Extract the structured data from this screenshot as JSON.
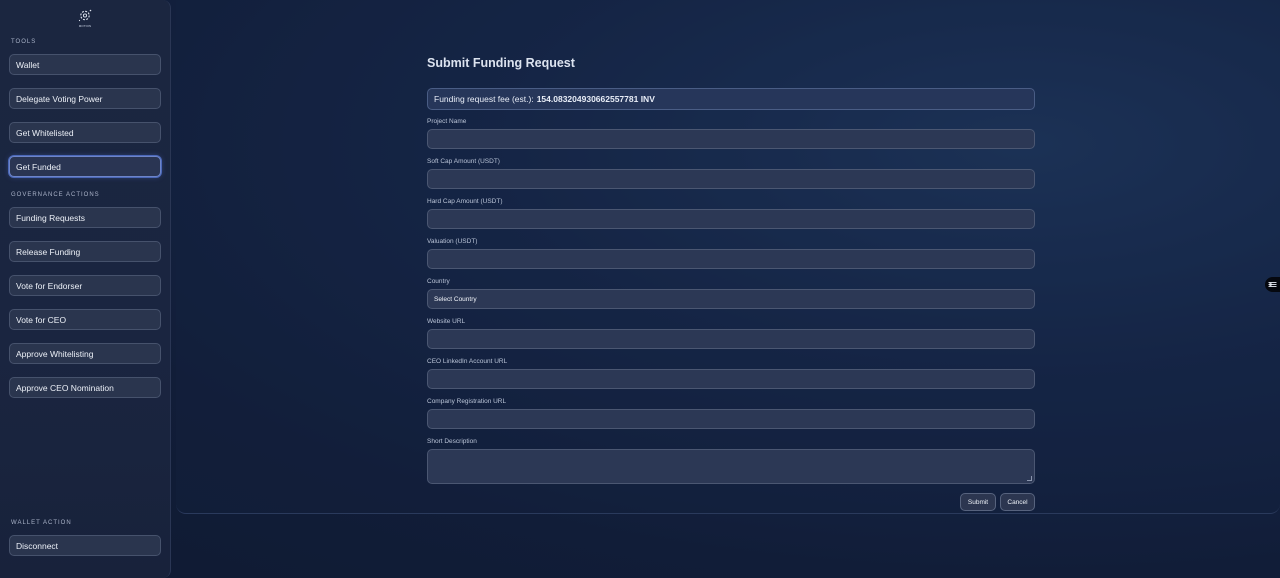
{
  "logo": {
    "icon": "gear-sparkle-icon",
    "text": "MOTION"
  },
  "sidebar": {
    "tools_label": "TOOLS",
    "tools": [
      {
        "label": "Wallet"
      },
      {
        "label": "Delegate Voting Power"
      },
      {
        "label": "Get Whitelisted"
      },
      {
        "label": "Get Funded",
        "active": true
      }
    ],
    "governance_label": "GOVERNANCE ACTIONS",
    "governance": [
      {
        "label": "Funding Requests"
      },
      {
        "label": "Release Funding"
      },
      {
        "label": "Vote for Endorser"
      },
      {
        "label": "Vote for CEO"
      },
      {
        "label": "Approve Whitelisting"
      },
      {
        "label": "Approve CEO Nomination"
      }
    ],
    "wallet_label": "WALLET ACTION",
    "disconnect": "Disconnect"
  },
  "form": {
    "title": "Submit Funding Request",
    "fee_prefix": "Funding request fee (est.):",
    "fee_value": "154.083204930662557781 INV",
    "fields": [
      {
        "label": "Project Name",
        "value": ""
      },
      {
        "label": "Soft Cap Amount (USDT)",
        "value": ""
      },
      {
        "label": "Hard Cap Amount (USDT)",
        "value": ""
      },
      {
        "label": "Valuation (USDT)",
        "value": ""
      },
      {
        "label": "Country",
        "value": "Select Country"
      },
      {
        "label": "Website URL",
        "value": ""
      },
      {
        "label": "CEO LinkedIn Account URL",
        "value": ""
      },
      {
        "label": "Company Registration URL",
        "value": ""
      },
      {
        "label": "Short Description",
        "value": ""
      }
    ],
    "submit": "Submit",
    "cancel": "Cancel"
  },
  "floating_icon": "settings-sliders-icon"
}
